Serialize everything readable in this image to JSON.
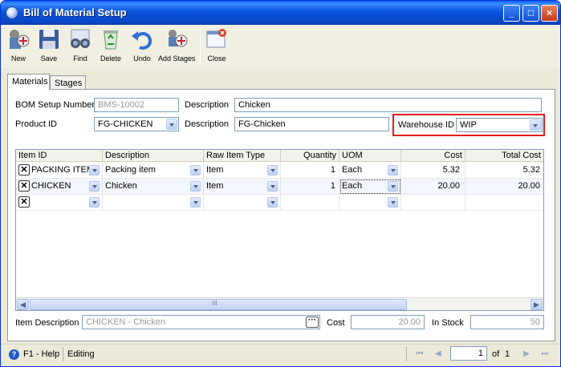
{
  "window": {
    "title": "Bill of Material Setup"
  },
  "toolbar": {
    "new": "New",
    "save": "Save",
    "find": "Find",
    "delete": "Delete",
    "undo": "Undo",
    "add_stages": "Add Stages",
    "close": "Close"
  },
  "tabs": [
    {
      "label": "Materials",
      "active": true
    },
    {
      "label": "Stages",
      "active": false
    }
  ],
  "form": {
    "bom_setup_number_label": "BOM Setup Number",
    "bom_setup_number": "BMS-10002",
    "description_label": "Description",
    "description": "Chicken",
    "product_id_label": "Product ID",
    "product_id": "FG-CHICKEN",
    "description2_label": "Description",
    "description2": "FG-Chicken",
    "warehouse_id_label": "Warehouse ID",
    "warehouse_id": "WIP"
  },
  "grid": {
    "columns": [
      "Item ID",
      "Description",
      "Raw Item Type",
      "Quantity",
      "UOM",
      "Cost",
      "Total Cost"
    ],
    "rows": [
      {
        "item_id": "PACKING ITEM",
        "description": "Packing item",
        "raw_item_type": "Item",
        "quantity": "1",
        "uom": "Each",
        "cost": "5.32",
        "total_cost": "5.32"
      },
      {
        "item_id": "CHICKEN",
        "description": "Chicken",
        "raw_item_type": "Item",
        "quantity": "1",
        "uom": "Each",
        "cost": "20.00",
        "total_cost": "20.00"
      },
      {
        "item_id": "",
        "description": "",
        "raw_item_type": "",
        "quantity": "",
        "uom": "",
        "cost": "",
        "total_cost": ""
      }
    ],
    "scroll_label": "III"
  },
  "footer": {
    "item_description_label": "Item Description",
    "item_description": "CHICKEN - Chicken",
    "cost_label": "Cost",
    "cost": "20.00",
    "in_stock_label": "In Stock",
    "in_stock": "50"
  },
  "status": {
    "help": "F1 - Help",
    "mode": "Editing",
    "page": "1",
    "of_label": "of",
    "total_pages": "1"
  },
  "colors": {
    "title_bar": "#0855DD",
    "highlight": "#E21C1C",
    "panel_bg": "#ECE9D8"
  }
}
